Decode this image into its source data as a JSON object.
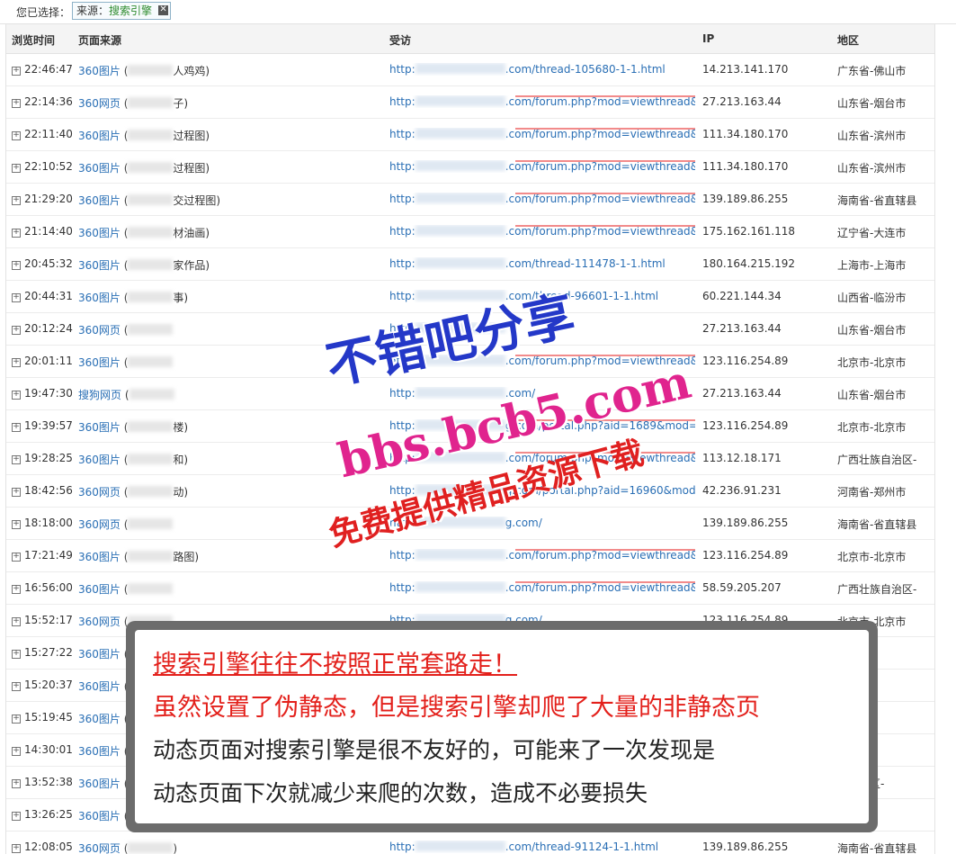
{
  "filter": {
    "label": "您已选择：",
    "tag_key": "来源：",
    "tag_value": "搜索引擎",
    "close": "✕"
  },
  "columns": {
    "time": "浏览时间",
    "source": "页面来源",
    "page": "受访",
    "ip": "IP",
    "region": "地区"
  },
  "rows": [
    {
      "time": "22:46:47",
      "src": "360图片",
      "kw": "人鸡鸡)",
      "url_a": "http:",
      "url_b": ".com/thread-105680-1-1.html",
      "ip": "14.213.141.170",
      "region": "广东省-佛山市",
      "ul": false
    },
    {
      "time": "22:14:36",
      "src": "360网页",
      "kw": "子)",
      "url_a": "http:",
      "url_b": ".com/forum.php?mod=viewthread&tid",
      "ip": "27.213.163.44",
      "region": "山东省-烟台市",
      "ul": true
    },
    {
      "time": "22:11:40",
      "src": "360图片",
      "kw": "过程图)",
      "url_a": "http:",
      "url_b": ".com/forum.php?mod=viewthread&tid",
      "ip": "111.34.180.170",
      "region": "山东省-滨州市",
      "ul": true
    },
    {
      "time": "22:10:52",
      "src": "360图片",
      "kw": "过程图)",
      "url_a": "http:",
      "url_b": ".com/forum.php?mod=viewthread&tid",
      "ip": "111.34.180.170",
      "region": "山东省-滨州市",
      "ul": true
    },
    {
      "time": "21:29:20",
      "src": "360图片",
      "kw": "交过程图)",
      "url_a": "http:",
      "url_b": ".com/forum.php?mod=viewthread&tid",
      "ip": "139.189.86.255",
      "region": "海南省-省直辖县",
      "ul": true
    },
    {
      "time": "21:14:40",
      "src": "360图片",
      "kw": "材油画)",
      "url_a": "http:",
      "url_b": ".com/forum.php?mod=viewthread&tid",
      "ip": "175.162.161.118",
      "region": "辽宁省-大连市",
      "ul": true
    },
    {
      "time": "20:45:32",
      "src": "360图片",
      "kw": "家作品)",
      "url_a": "http:",
      "url_b": ".com/thread-111478-1-1.html",
      "ip": "180.164.215.192",
      "region": "上海市-上海市",
      "ul": false
    },
    {
      "time": "20:44:31",
      "src": "360图片",
      "kw": "事)",
      "url_a": "http:",
      "url_b": ".com/thread-96601-1-1.html",
      "ip": "60.221.144.34",
      "region": "山西省-临汾市",
      "ul": false
    },
    {
      "time": "20:12:24",
      "src": "360网页",
      "kw": "",
      "url_a": "http:",
      "url_b": "",
      "ip": "27.213.163.44",
      "region": "山东省-烟台市",
      "ul": false
    },
    {
      "time": "20:01:11",
      "src": "360图片",
      "kw": "",
      "url_a": "http:",
      "url_b": ".com/forum.php?mod=viewthread&tid",
      "ip": "123.116.254.89",
      "region": "北京市-北京市",
      "ul": true
    },
    {
      "time": "19:47:30",
      "src": "搜狗网页",
      "kw": "",
      "url_a": "http:",
      "url_b": ".com/",
      "ip": "27.213.163.44",
      "region": "山东省-烟台市",
      "ul": false
    },
    {
      "time": "19:39:57",
      "src": "360图片",
      "kw": "楼)",
      "url_a": "http:",
      "url_b": "g.com/portal.php?aid=1689&mod=vie",
      "ip": "123.116.254.89",
      "region": "北京市-北京市",
      "ul": true
    },
    {
      "time": "19:28:25",
      "src": "360图片",
      "kw": "和)",
      "url_a": "http:",
      "url_b": ".com/forum.php?mod=viewthread&tid",
      "ip": "113.12.18.171",
      "region": "广西壮族自治区-",
      "ul": true
    },
    {
      "time": "18:42:56",
      "src": "360网页",
      "kw": "动)",
      "url_a": "http:",
      "url_b": "g.com/portal.php?aid=16960&mod=vi",
      "ip": "42.236.91.231",
      "region": "河南省-郑州市",
      "ul": false
    },
    {
      "time": "18:18:00",
      "src": "360网页",
      "kw": "",
      "url_a": "http:",
      "url_b": "g.com/",
      "ip": "139.189.86.255",
      "region": "海南省-省直辖县",
      "ul": false
    },
    {
      "time": "17:21:49",
      "src": "360图片",
      "kw": "路图)",
      "url_a": "http:",
      "url_b": ".com/forum.php?mod=viewthread&tid",
      "ip": "123.116.254.89",
      "region": "北京市-北京市",
      "ul": true
    },
    {
      "time": "16:56:00",
      "src": "360图片",
      "kw": "",
      "url_a": "http:",
      "url_b": ".com/forum.php?mod=viewthread&tid",
      "ip": "58.59.205.207",
      "region": "广西壮族自治区-",
      "ul": true
    },
    {
      "time": "15:52:17",
      "src": "360网页",
      "kw": "",
      "url_a": "http:",
      "url_b": "g.com/",
      "ip": "123.116.254.89",
      "region": "北京市-北京市",
      "ul": false
    },
    {
      "time": "15:27:22",
      "src": "360图片",
      "kw": "",
      "url_a": "",
      "url_b": "",
      "ip": "",
      "region": "-阜新市",
      "ul": false
    },
    {
      "time": "15:20:37",
      "src": "360图片",
      "kw": "",
      "url_a": "",
      "url_b": "",
      "ip": "",
      "region": "-烟台市",
      "ul": false
    },
    {
      "time": "15:19:45",
      "src": "360图片",
      "kw": "",
      "url_a": "",
      "url_b": "",
      "ip": "",
      "region": "-烟台市",
      "ul": false
    },
    {
      "time": "14:30:01",
      "src": "360图片",
      "kw": "",
      "url_a": "",
      "url_b": "",
      "ip": "",
      "region": "-忻州市",
      "ul": false
    },
    {
      "time": "13:52:38",
      "src": "360图片",
      "kw": "",
      "url_a": "",
      "url_b": "",
      "ip": "",
      "region": "族自治区-",
      "ul": false
    },
    {
      "time": "13:26:25",
      "src": "360图片",
      "kw": "",
      "url_a": "",
      "url_b": "",
      "ip": "",
      "region": "-北京市",
      "ul": false
    },
    {
      "time": "12:08:05",
      "src": "360网页",
      "kw": ")",
      "url_a": "http:",
      "url_b": ".com/thread-91124-1-1.html",
      "ip": "139.189.86.255",
      "region": "海南省-省直辖县",
      "ul": false
    }
  ],
  "watermark": {
    "line1": "不错吧分享",
    "line2": "bbs.bcb5.com",
    "line3": "免费提供精品资源下载"
  },
  "notice": {
    "line1": "搜索引擎往往不按照正常套路走！",
    "line2": "虽然设置了伪静态，但是搜索引擎却爬了大量的非静态页",
    "line3": "动态页面对搜索引擎是很不友好的，可能来了一次发现是",
    "line4": "动态页面下次就减少来爬的次数，造成不必要损失"
  }
}
